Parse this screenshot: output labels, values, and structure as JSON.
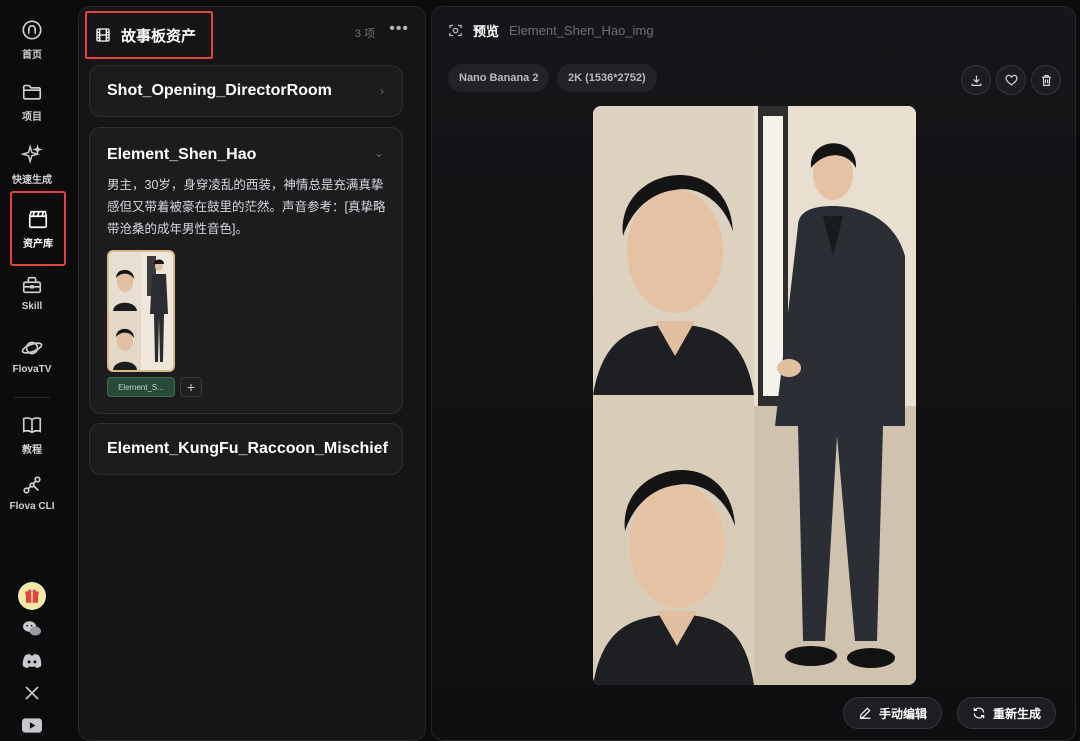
{
  "sidebar": {
    "items": [
      {
        "label": "首页",
        "icon": "home-icon"
      },
      {
        "label": "项目",
        "icon": "folder-icon"
      },
      {
        "label": "快速生成",
        "icon": "sparkle-icon"
      },
      {
        "label": "资产库",
        "icon": "clapperboard-icon"
      },
      {
        "label": "Skill",
        "icon": "toolbox-icon"
      },
      {
        "label": "FlovaTV",
        "icon": "planet-icon"
      },
      {
        "label": "教程",
        "icon": "book-icon"
      },
      {
        "label": "Flova CLI",
        "icon": "nodes-icon"
      }
    ],
    "active_index": 3,
    "social": [
      "gift-icon",
      "wechat-icon",
      "discord-icon",
      "x-icon",
      "youtube-icon"
    ]
  },
  "panel": {
    "title": "故事板资产",
    "count": "3 项",
    "more": "•••",
    "cards": [
      {
        "title": "Shot_Opening_DirectorRoom",
        "expanded": false
      },
      {
        "title": "Element_Shen_Hao",
        "expanded": true,
        "description": "男主，30岁，身穿凌乱的西装，神情总是充满真挚感但又带着被豪在鼓里的茫然。声音参考：[真挚略带沧桑的成年男性音色]。",
        "tag": "Element_S...",
        "add": "+"
      },
      {
        "title": "Element_KungFu_Raccoon_Mischief",
        "expanded": false
      }
    ]
  },
  "preview": {
    "title": "预览",
    "subtitle": "Element_Shen_Hao_img",
    "chips": [
      "Nano Banana 2",
      "2K (1536*2752)"
    ],
    "actions": {
      "edit": "手动编辑",
      "regenerate": "重新生成"
    }
  },
  "colors": {
    "highlight": "#e0453c",
    "tag_bg": "#2a4a39",
    "background": "#0b0b0d"
  }
}
